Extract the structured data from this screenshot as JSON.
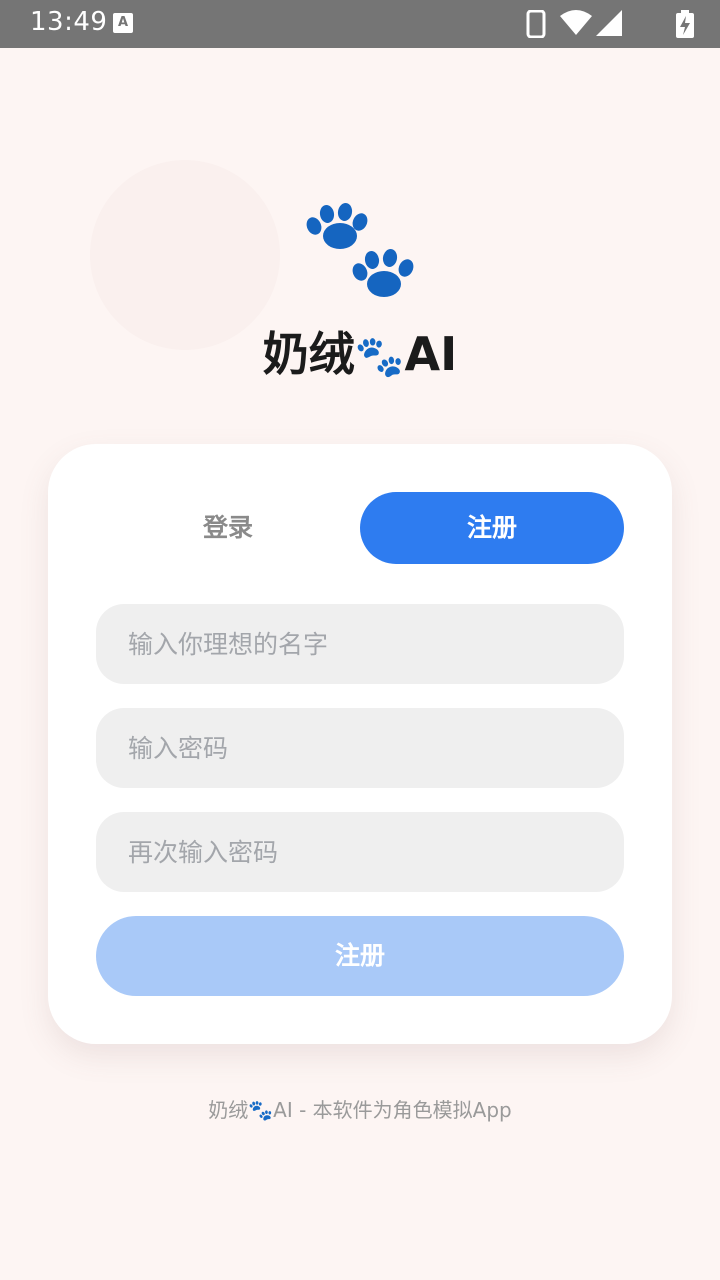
{
  "status_bar": {
    "time": "13:49",
    "notification_icon_letter": "A",
    "icons": [
      "phone-icon",
      "wifi-icon",
      "signal-icon",
      "battery-charging-icon"
    ]
  },
  "app": {
    "name_prefix": "奶绒",
    "name_emoji": "🐾",
    "name_suffix": "AI",
    "logo_icon": "paw-prints-icon",
    "logo_color": "#1565c0"
  },
  "tabs": {
    "login_label": "登录",
    "register_label": "注册",
    "active": "register",
    "active_color": "#2e7cf0"
  },
  "form": {
    "name_placeholder": "输入你理想的名字",
    "password_placeholder": "输入密码",
    "confirm_password_placeholder": "再次输入密码",
    "submit_label": "注册",
    "submit_color": "#a9c9f8"
  },
  "footer": {
    "prefix": "奶绒",
    "emoji": "🐾",
    "suffix": "AI - 本软件为角色模拟App"
  }
}
